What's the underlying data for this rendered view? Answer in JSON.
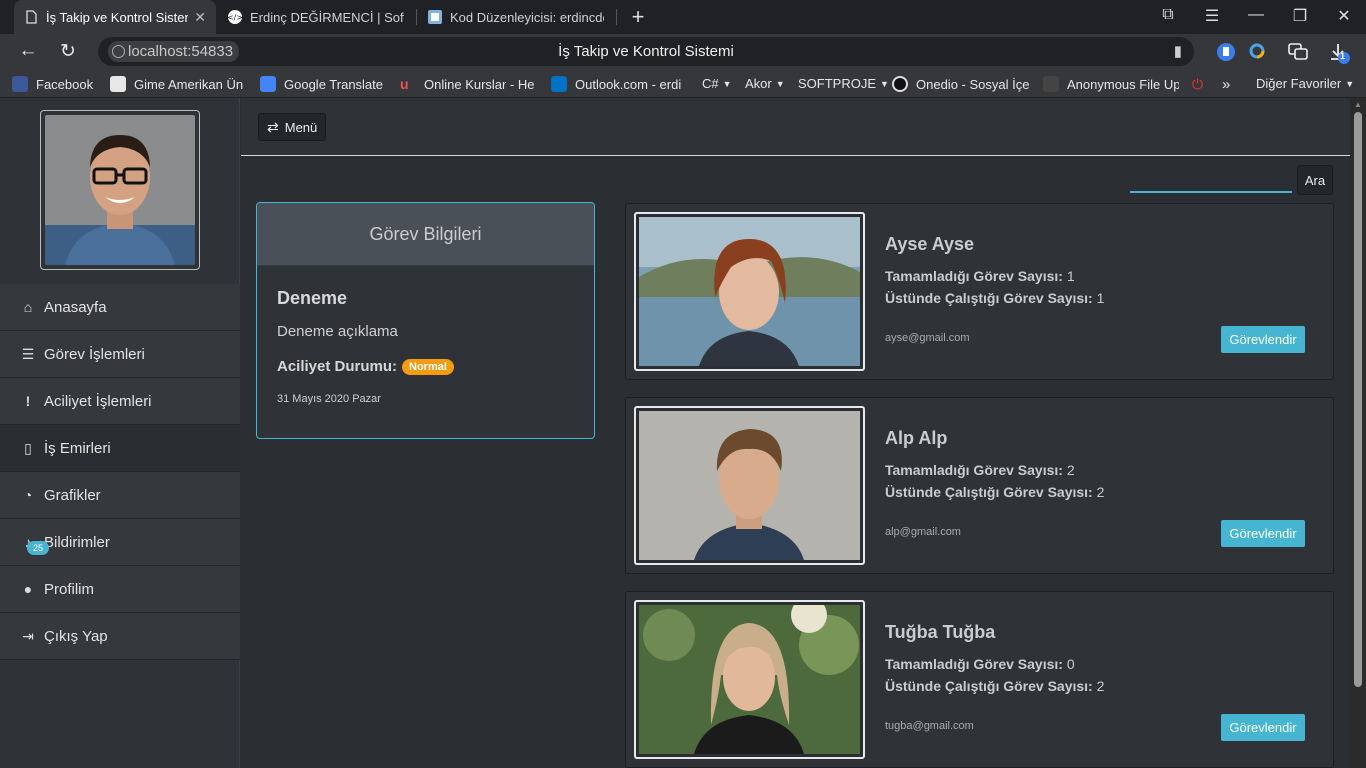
{
  "browser": {
    "tabs": [
      {
        "title": "İş Takip ve Kontrol Sistemi",
        "active": true
      },
      {
        "title": "Erdinç DEĞİRMENCİ | Software",
        "active": false
      },
      {
        "title": "Kod Düzenleyicisi: erdincdegirmenci",
        "active": false
      }
    ],
    "new_tab_icon": "+",
    "url": "localhost:54833",
    "page_title": "İş Takip ve Kontrol Sistemi",
    "extension_badge": "1",
    "bookmarks": [
      {
        "label": "Facebook",
        "icon_color": "#3b5998"
      },
      {
        "label": "Gime Amerikan Ün",
        "icon_color": "#e8e8e8"
      },
      {
        "label": "Google Translate",
        "icon_color": "#4285f4"
      },
      {
        "label": "Online Kurslar - He",
        "icon_color": "#ec5252"
      },
      {
        "label": "Outlook.com - erdi",
        "icon_color": "#0072c6"
      },
      {
        "label": "C#",
        "icon_color": "",
        "folder": true
      },
      {
        "label": "Akor",
        "icon_color": "",
        "folder": true
      },
      {
        "label": "SOFTPROJE",
        "icon_color": "",
        "folder": true
      },
      {
        "label": "Onedio - Sosyal İçe",
        "icon_color": "#111111"
      },
      {
        "label": "Anonymous File Up",
        "icon_color": "#444444"
      },
      {
        "label": "Diğer Favoriler",
        "icon_color": "",
        "folder": true
      }
    ],
    "more_bookmarks": "»"
  },
  "sidebar": {
    "items": [
      {
        "label": "Anasayfa",
        "icon": "home-icon",
        "glyph": "⌂"
      },
      {
        "label": "Görev İşlemleri",
        "icon": "tasks-icon",
        "glyph": "☰"
      },
      {
        "label": "Aciliyet İşlemleri",
        "icon": "exclamation-icon",
        "glyph": "!"
      },
      {
        "label": "İş Emirleri",
        "icon": "file-icon",
        "glyph": "▯"
      },
      {
        "label": "Grafikler",
        "icon": "pie-chart-icon",
        "glyph": "◔"
      },
      {
        "label": "Bildirimler",
        "icon": "bell-icon",
        "glyph": "♪"
      },
      {
        "label": "Profilim",
        "icon": "user-icon",
        "glyph": "●"
      },
      {
        "label": "Çıkış Yap",
        "icon": "sign-out-icon",
        "glyph": "⇥"
      }
    ],
    "notification_count": "25"
  },
  "topbar": {
    "menu_label": "Menü"
  },
  "search": {
    "placeholder": "",
    "button_label": "Ara"
  },
  "task": {
    "header": "Görev Bilgileri",
    "title": "Deneme",
    "description": "Deneme açıklama",
    "urgency_label": "Aciliyet Durumu:",
    "urgency_value": "Normal",
    "urgency_color": "#f39c12",
    "date": "31 Mayıs 2020 Pazar"
  },
  "users": [
    {
      "name": "Ayse Ayse",
      "completed_label": "Tamamladığı Görev Sayısı:",
      "completed": "1",
      "working_label": "Üstünde Çalıştığı Görev Sayısı:",
      "working": "1",
      "email": "ayse@gmail.com",
      "button": "Görevlendir"
    },
    {
      "name": "Alp Alp",
      "completed_label": "Tamamladığı Görev Sayısı:",
      "completed": "2",
      "working_label": "Üstünde Çalıştığı Görev Sayısı:",
      "working": "2",
      "email": "alp@gmail.com",
      "button": "Görevlendir"
    },
    {
      "name": "Tuğba Tuğba",
      "completed_label": "Tamamladığı Görev Sayısı:",
      "completed": "0",
      "working_label": "Üstünde Çalıştığı Görev Sayısı:",
      "working": "2",
      "email": "tugba@gmail.com",
      "button": "Görevlendir"
    }
  ],
  "colors": {
    "accent": "#46b5d1",
    "urgency_normal": "#f39c12",
    "sidebar_bg": "#35383d",
    "page_bg": "#2b2e33"
  }
}
